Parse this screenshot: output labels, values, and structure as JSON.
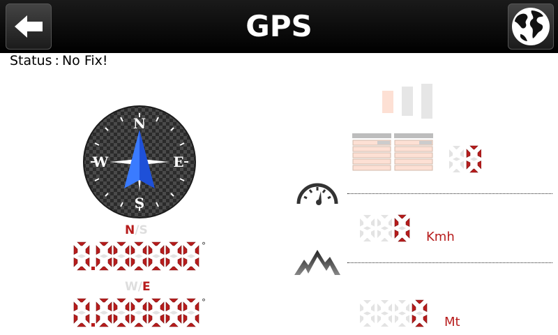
{
  "header": {
    "title": "GPS",
    "back_icon": "arrow-left-icon",
    "globe_icon": "globe-icon"
  },
  "status": {
    "label": "Status",
    "separator": ":",
    "value": "No Fix!"
  },
  "compass": {
    "north": "N",
    "south": "S",
    "east": "E",
    "west": "W",
    "needle_color": "#2a5cff"
  },
  "coordinates": {
    "latitude": {
      "active": "N",
      "divider": "/",
      "inactive": "S",
      "value": "0.000000",
      "degree": "°"
    },
    "longitude": {
      "inactive": "W",
      "divider": "/",
      "active": "E",
      "value": "0.000000",
      "degree": "°"
    }
  },
  "satellites": {
    "count": "0",
    "signal_icon": "signal-strength-icon"
  },
  "speed": {
    "value": "0",
    "unit": "Kmh",
    "icon": "speedometer-icon"
  },
  "altitude": {
    "value": "0",
    "unit": "Mt",
    "icon": "mountain-icon"
  },
  "colors": {
    "accent": "#b71c1c",
    "segment_off": "#e3e3e3",
    "header": "#000000"
  }
}
